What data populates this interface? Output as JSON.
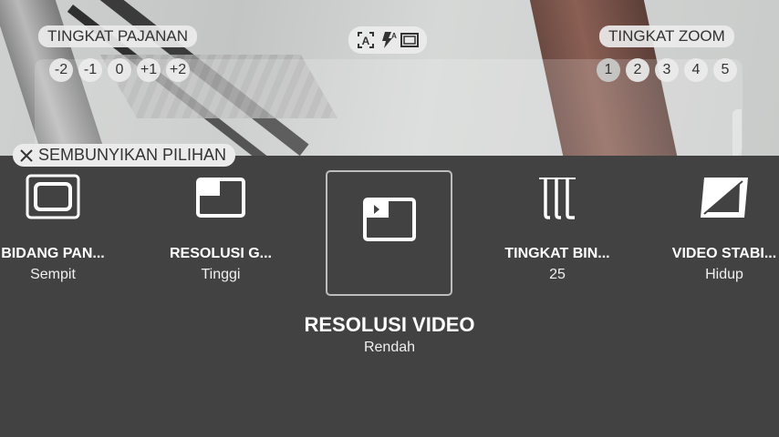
{
  "exposure": {
    "label": "TINGKAT PAJANAN",
    "levels": [
      "-2",
      "-1",
      "0",
      "+1",
      "+2"
    ],
    "selected": "0"
  },
  "zoom": {
    "label": "TINGKAT ZOOM",
    "levels": [
      "1",
      "2",
      "3",
      "4",
      "5"
    ],
    "selected": "1"
  },
  "modes": {
    "icons": [
      "auto-focus-icon",
      "flash-auto-icon",
      "aspect-ratio-icon"
    ]
  },
  "hide_options": {
    "label": "SEMBUNYIKAN PILIHAN"
  },
  "options": [
    {
      "name": "BIDANG PAN...",
      "value": "Sempit",
      "icon": "field-of-view-icon"
    },
    {
      "name": "RESOLUSI G...",
      "value": "Tinggi",
      "icon": "photo-resolution-icon"
    },
    {
      "name": "RESOLUSI VIDEO",
      "value": "Rendah",
      "icon": "video-resolution-icon",
      "selected": true
    },
    {
      "name": "TINGKAT BIN...",
      "value": "25",
      "icon": "frame-rate-icon"
    },
    {
      "name": "VIDEO STABI...",
      "value": "Hidup",
      "icon": "video-stabilization-icon"
    }
  ],
  "colors": {
    "panel_bg": "#424242",
    "pill_bg": "#ebebeb",
    "text_light": "#ffffff"
  }
}
